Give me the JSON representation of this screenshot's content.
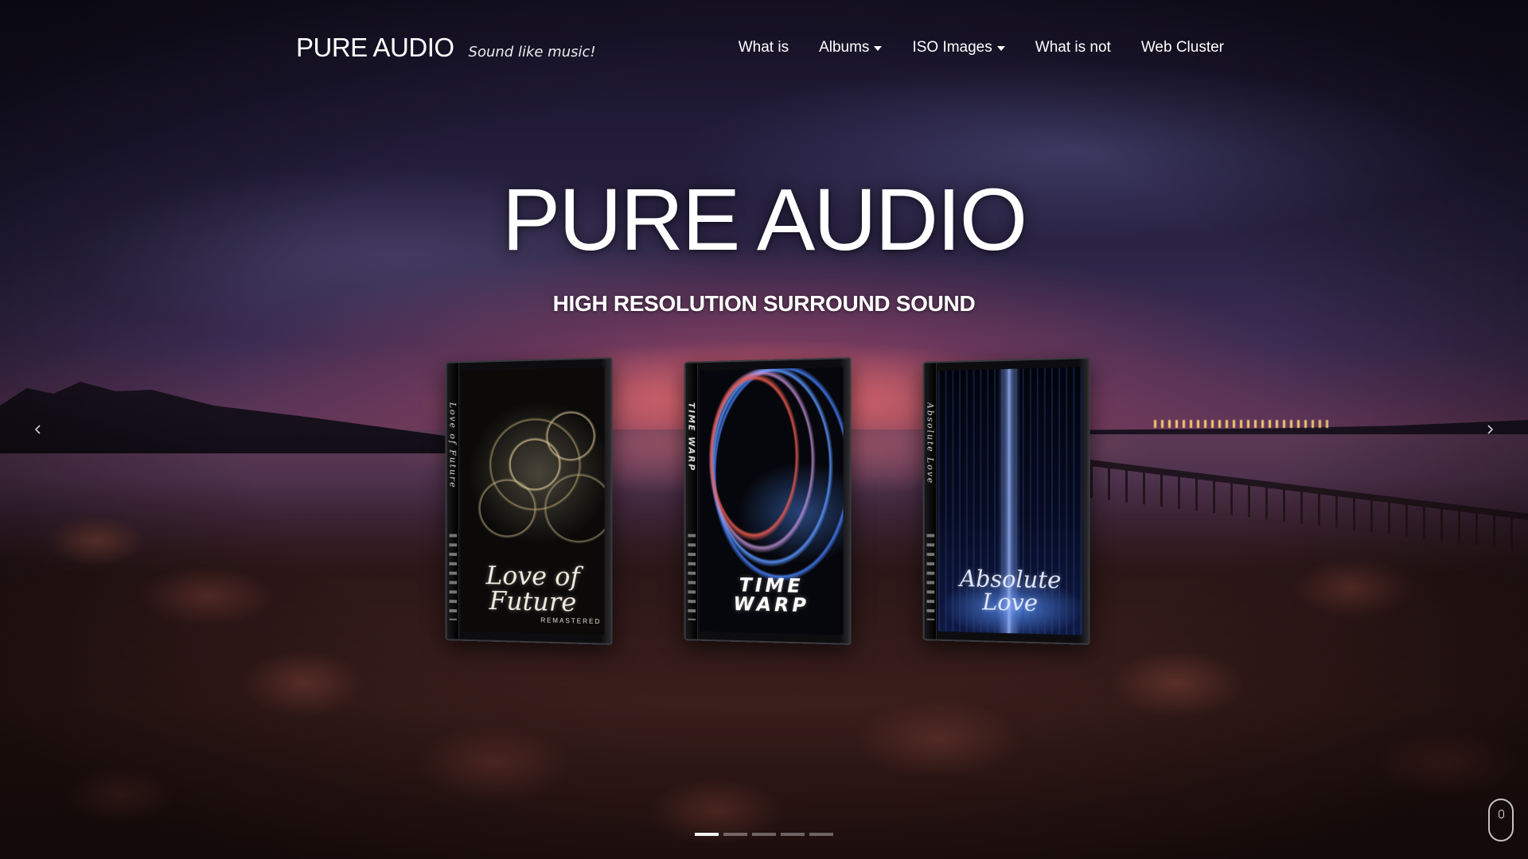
{
  "header": {
    "brand": "PURE AUDIO",
    "tagline": "Sound like music!",
    "nav": [
      {
        "label": "What is",
        "dropdown": false
      },
      {
        "label": "Albums",
        "dropdown": true
      },
      {
        "label": "ISO Images",
        "dropdown": true
      },
      {
        "label": "What is not",
        "dropdown": false
      },
      {
        "label": "Web Cluster",
        "dropdown": false
      }
    ]
  },
  "hero": {
    "title": "PURE AUDIO",
    "subtitle": "HIGH RESOLUTION SURROUND SOUND"
  },
  "albums": [
    {
      "title": "Love of Future",
      "subtitle": "REMASTERED",
      "spine": "Love of Future Remastered"
    },
    {
      "title": "TIME WARP",
      "subtitle": "",
      "spine": "TIME WARP"
    },
    {
      "title": "Absolute Love",
      "subtitle": "",
      "spine": "Absolute Love"
    }
  ],
  "carousel": {
    "slide_count": 5,
    "active_index": 0,
    "prev_icon": "chevron-left-icon",
    "next_icon": "chevron-right-icon"
  },
  "scroll_hint_icon": "mouse-scroll-icon",
  "colors": {
    "text": "#ffffff",
    "indicator_active": "#ffffff",
    "indicator_inactive": "rgba(255,255,255,0.35)"
  }
}
